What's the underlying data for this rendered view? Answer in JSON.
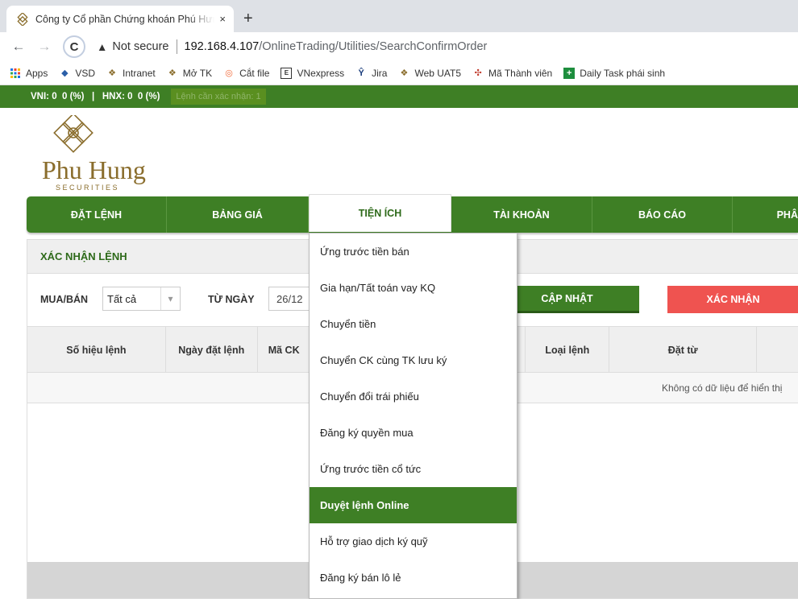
{
  "browser": {
    "tab_title": "Công ty Cổ phần Chứng khoán Phú Hưng",
    "tab_close": "×",
    "new_tab": "+",
    "back": "←",
    "forward": "→",
    "reload": "C",
    "security_icon": "▲",
    "security_text": "Not secure",
    "url_host": "192.168.4.107",
    "url_path": "/OnlineTrading/Utilities/SearchConfirmOrder",
    "bookmarks": [
      "Apps",
      "VSD",
      "Intranet",
      "Mở TK",
      "Cắt file",
      "VNexpress",
      "Jira",
      "Web UAT5",
      "Mã Thành viên",
      "Daily Task phái sinh"
    ]
  },
  "indexbar": {
    "text": "VNI: 0  0 (%)   |   HNX: 0  0 (%)",
    "pending": "Lệnh cần xác nhận: 1"
  },
  "logo": {
    "brand": "Phu Hung",
    "sub": "SECURITIES"
  },
  "nav": {
    "items": [
      "ĐẶT LỆNH",
      "BẢNG GIÁ",
      "TIỆN ÍCH",
      "TÀI KHOẢN",
      "BÁO CÁO",
      "PHÂ"
    ]
  },
  "panel": {
    "title": "XÁC NHẬN LỆNH",
    "filter": {
      "buysell_label": "MUA/BÁN",
      "buysell_value": "Tất cả",
      "from_label": "TỪ NGÀY",
      "from_value": "26/12",
      "update_button": "CẬP NHẬT",
      "confirm_button": "XÁC NHẬN"
    },
    "columns": [
      "Số hiệu lệnh",
      "Ngày đặt lệnh",
      "Mã CK",
      "",
      "Loại lệnh",
      "Đặt từ",
      ""
    ],
    "empty_message": "Không có dữ liệu để hiển thị"
  },
  "dropdown": {
    "items": [
      "Ứng trước tiền bán",
      "Gia hạn/Tất toán vay KQ",
      "Chuyển tiền",
      "Chuyển CK cùng TK lưu ký",
      "Chuyển đổi trái phiếu",
      "Đăng ký quyền mua",
      "Ứng trước tiền cổ tức",
      "Duyệt lệnh Online",
      "Hỗ trợ giao dịch ký quỹ",
      "Đăng ký bán lô lẻ"
    ],
    "active_index": 7
  },
  "colors": {
    "brand_green": "#3e7f25",
    "confirm_red": "#ef5350",
    "logo_gold": "#8a6d2c"
  }
}
